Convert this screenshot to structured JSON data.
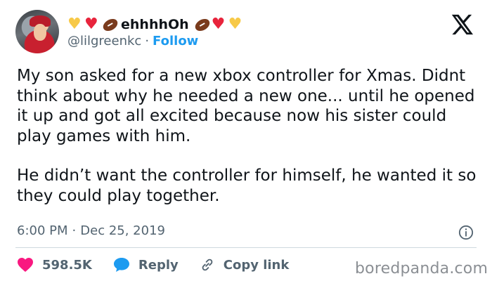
{
  "author": {
    "display_name": "ehhhhOh",
    "handle": "@lilgreenkc",
    "follow_label": "Follow",
    "separator": "·",
    "emojis_left": [
      "yellow-heart",
      "red-heart",
      "football"
    ],
    "emojis_right": [
      "football",
      "red-heart",
      "yellow-heart"
    ]
  },
  "tweet": {
    "paragraph_1": "My son asked for a new xbox controller for Xmas. Didnt think about why he needed a new one... until he opened it up and got all excited because now his sister could play games with him.",
    "paragraph_2": "He didn’t want the controller for himself, he wanted it so they could play together."
  },
  "meta": {
    "time": "6:00 PM",
    "separator": "·",
    "date": "Dec 25, 2019"
  },
  "actions": {
    "like_count": "598.5K",
    "reply_label": "Reply",
    "copy_label": "Copy link"
  },
  "watermark": "boredpanda.com",
  "colors": {
    "accent": "#1d9bf0",
    "like": "#f91880",
    "text": "#0f1419",
    "muted": "#536471"
  }
}
